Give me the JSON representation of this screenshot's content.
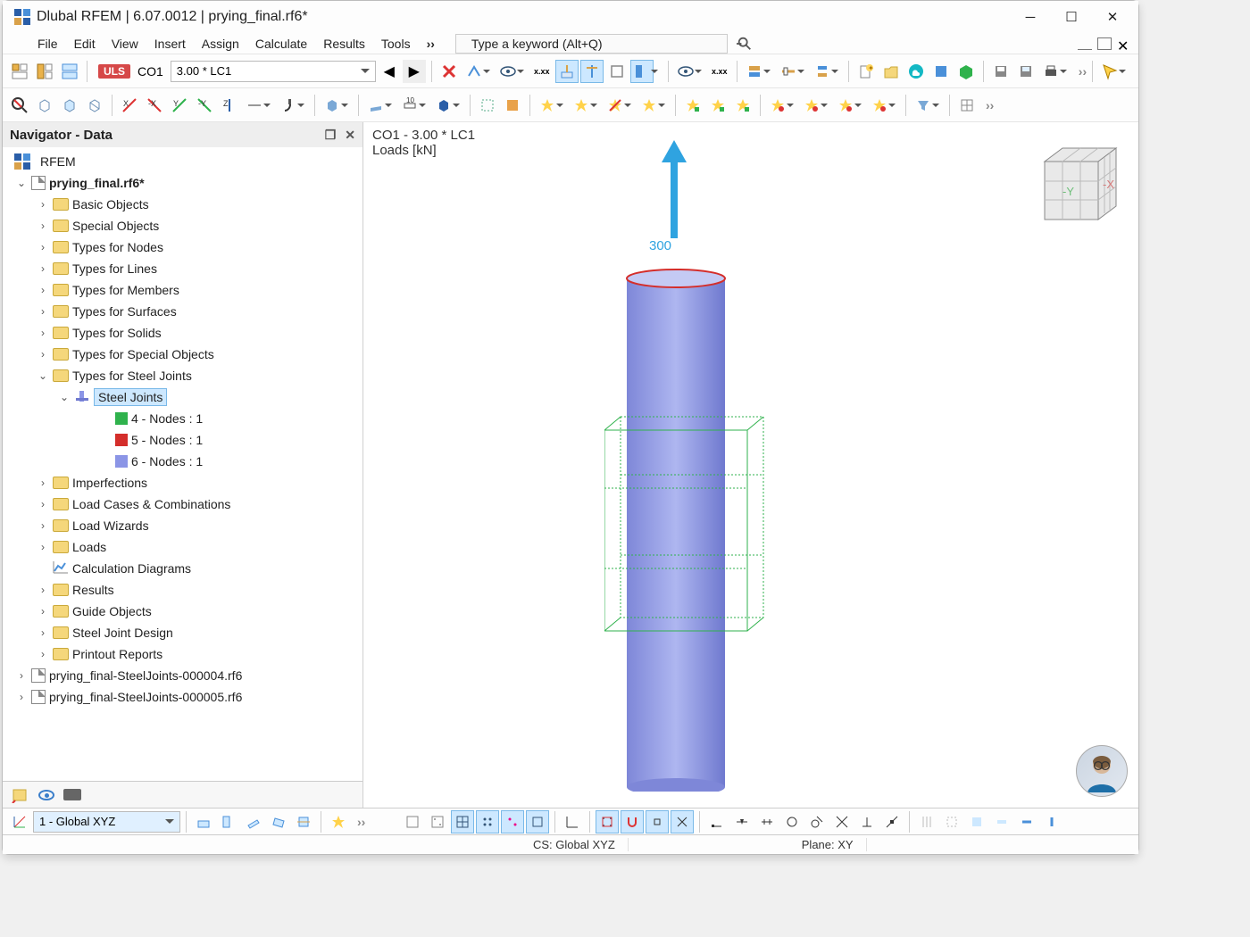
{
  "title": "Dlubal RFEM | 6.07.0012 | prying_final.rf6*",
  "menu": [
    "File",
    "Edit",
    "View",
    "Insert",
    "Assign",
    "Calculate",
    "Results",
    "Tools"
  ],
  "search_placeholder": "Type a keyword (Alt+Q)",
  "uls": "ULS",
  "combo_code": "CO1",
  "combo_expr": "3.00 * LC1",
  "navigator": {
    "title": "Navigator - Data",
    "root": "RFEM",
    "model": "prying_final.rf6*",
    "items": [
      "Basic Objects",
      "Special Objects",
      "Types for Nodes",
      "Types for Lines",
      "Types for Members",
      "Types for Surfaces",
      "Types for Solids",
      "Types for Special Objects"
    ],
    "steel_group": "Types for Steel Joints",
    "steel_joints": "Steel Joints",
    "joints": [
      {
        "label": "4 - Nodes : 1",
        "color": "#2fb24c"
      },
      {
        "label": "5 - Nodes : 1",
        "color": "#d42e2b"
      },
      {
        "label": "6 - Nodes : 1",
        "color": "#8b95e6"
      }
    ],
    "items2": [
      "Imperfections",
      "Load Cases & Combinations",
      "Load Wizards",
      "Loads",
      "Calculation Diagrams",
      "Results",
      "Guide Objects",
      "Steel Joint Design",
      "Printout Reports"
    ],
    "extras": [
      "prying_final-SteelJoints-000004.rf6",
      "prying_final-SteelJoints-000005.rf6"
    ]
  },
  "viewport": {
    "line1": "CO1 - 3.00 * LC1",
    "line2": "Loads [kN]",
    "load_value": "300"
  },
  "bottom": {
    "cs_combo": "1 - Global XYZ",
    "status_cs": "CS: Global XYZ",
    "status_plane": "Plane: XY"
  }
}
